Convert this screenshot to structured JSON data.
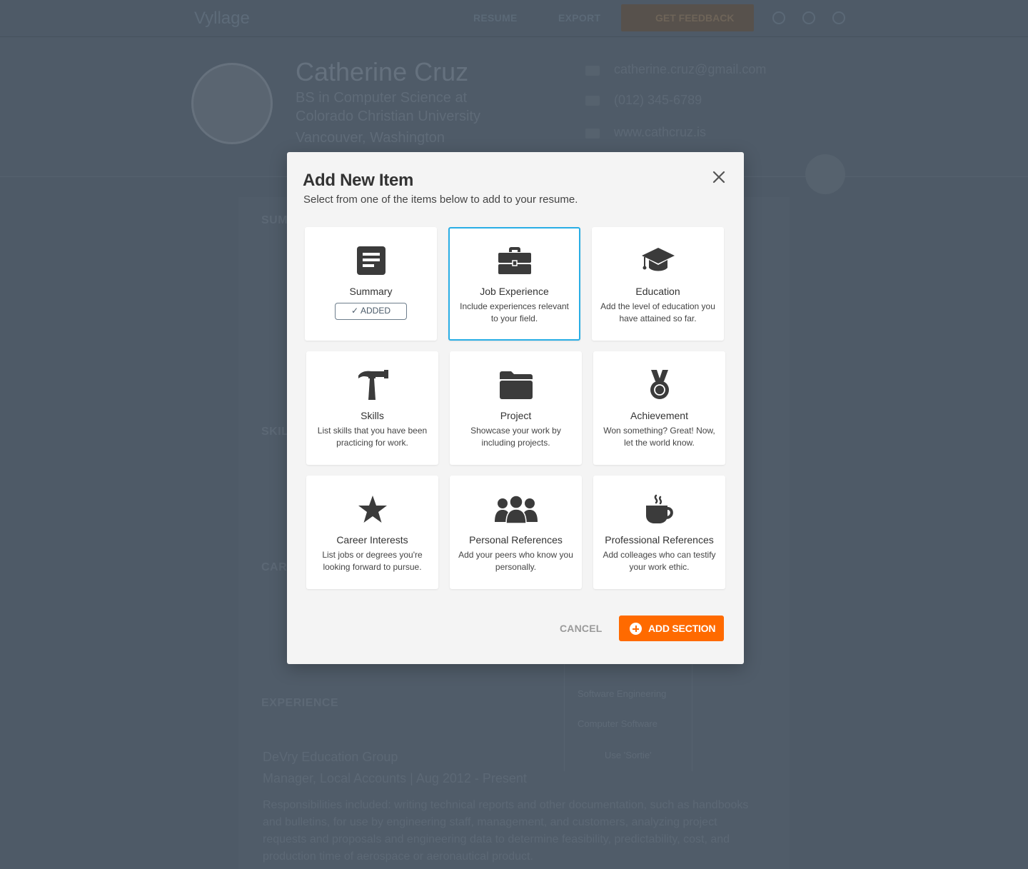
{
  "app": {
    "brand": "Vyllage"
  },
  "nav": {
    "resume": "RESUME",
    "export": "EXPORT",
    "feedback": "GET FEEDBACK"
  },
  "profile": {
    "name": "Catherine Cruz",
    "degree_line1": "BS in Computer Science at",
    "degree_line2": "Colorado Christian University",
    "location": "Vancouver, Washington",
    "email": "catherine.cruz@gmail.com",
    "phone": "(012) 345-6789",
    "website": "www.cathcruz.is"
  },
  "background": {
    "summary_heading": "SUMMARY",
    "skills_heading": "SKILLS",
    "career_heading": "CAREER",
    "experience_heading": "EXPERIENCE",
    "company": "DeVry Education Group",
    "job_line": "Manager, Local Accounts  |  Aug 2012 - Present",
    "job_text": "Responsibilities included: writing technical reports and other documentation, such as handbooks and bulletins, for use by engineering staff, management, and customers, analyzing project requests and proposals and engineering data to determine feasibility, predictability, cost, and production time of aerospace or aeronautical product.",
    "side_items": [
      "Software Engineering",
      "Computer Software",
      "Use 'Sortie'"
    ]
  },
  "modal": {
    "title": "Add New Item",
    "subtitle": "Select from one of the items below to add to your resume.",
    "cancel_label": "CANCEL",
    "add_label": "ADD SECTION",
    "added_badge": "ADDED",
    "accent_color": "#ff6a00",
    "selected_color": "#29aee5",
    "items": [
      {
        "label": "Summary",
        "icon": "document-icon",
        "added": true,
        "desc": ""
      },
      {
        "label": "Job Experience",
        "icon": "briefcase-icon",
        "selected": true,
        "desc": "Include experiences relevant to your field."
      },
      {
        "label": "Education",
        "icon": "graduation-cap-icon",
        "desc": "Add the level of education you have attained so far."
      },
      {
        "label": "Skills",
        "icon": "hammer-icon",
        "desc": "List skills that you have been practicing for work."
      },
      {
        "label": "Project",
        "icon": "folder-icon",
        "desc": "Showcase your work by including projects."
      },
      {
        "label": "Achievement",
        "icon": "medal-icon",
        "desc": "Won something? Great! Now, let the world know."
      },
      {
        "label": "Career Interests",
        "icon": "star-icon",
        "desc": "List jobs or degrees  you're looking forward to pursue."
      },
      {
        "label": "Personal References",
        "icon": "people-icon",
        "desc": "Add your peers who know you personally."
      },
      {
        "label": "Professional References",
        "icon": "coffee-cup-icon",
        "desc": "Add colleages who can testify your work ethic."
      }
    ]
  }
}
